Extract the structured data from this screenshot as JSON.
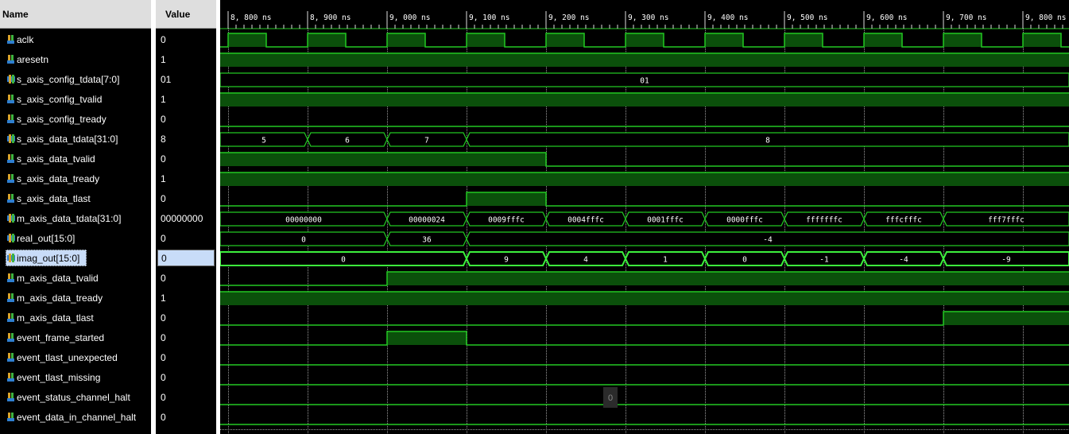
{
  "header": {
    "name_label": "Name",
    "value_label": "Value"
  },
  "time_ticks": [
    "8, 800 ns",
    "8, 900 ns",
    "9, 000 ns",
    "9, 100 ns",
    "9, 200 ns",
    "9, 300 ns",
    "9, 400 ns",
    "9, 500 ns",
    "9, 600 ns",
    "9, 700 ns",
    "9, 800 ns"
  ],
  "colors": {
    "wave": "#22c822",
    "fill": "#0b500b",
    "background": "#000000",
    "selected_value": "#c8dcf8"
  },
  "signals": [
    {
      "name": "aclk",
      "value": "0",
      "icon": "bit-signal-icon",
      "wave": {
        "type": "clock"
      }
    },
    {
      "name": "aresetn",
      "value": "1",
      "icon": "bit-signal-icon",
      "wave": {
        "type": "bit",
        "segments": [
          [
            0,
            10,
            1
          ]
        ]
      }
    },
    {
      "name": "s_axis_config_tdata[7:0]",
      "value": "01",
      "icon": "bus-signal-icon",
      "wave": {
        "type": "bus",
        "segments": [
          [
            0,
            10,
            "01"
          ]
        ]
      }
    },
    {
      "name": "s_axis_config_tvalid",
      "value": "1",
      "icon": "bit-signal-icon",
      "wave": {
        "type": "bit",
        "segments": [
          [
            0,
            10,
            1
          ]
        ]
      }
    },
    {
      "name": "s_axis_config_tready",
      "value": "0",
      "icon": "bit-signal-icon",
      "wave": {
        "type": "bit",
        "segments": [
          [
            0,
            10,
            0
          ]
        ]
      }
    },
    {
      "name": "s_axis_data_tdata[31:0]",
      "value": "8",
      "icon": "bus-signal-icon",
      "wave": {
        "type": "bus",
        "segments": [
          [
            0,
            1,
            "5"
          ],
          [
            1,
            2,
            "6"
          ],
          [
            2,
            3,
            "7"
          ],
          [
            3,
            10,
            "8"
          ]
        ]
      }
    },
    {
      "name": "s_axis_data_tvalid",
      "value": "0",
      "icon": "bit-signal-icon",
      "wave": {
        "type": "bit",
        "segments": [
          [
            0,
            4,
            1
          ],
          [
            4,
            10,
            0
          ]
        ]
      }
    },
    {
      "name": "s_axis_data_tready",
      "value": "1",
      "icon": "bit-signal-icon",
      "wave": {
        "type": "bit",
        "segments": [
          [
            0,
            10,
            1
          ]
        ]
      }
    },
    {
      "name": "s_axis_data_tlast",
      "value": "0",
      "icon": "bit-signal-icon",
      "wave": {
        "type": "bit",
        "segments": [
          [
            0,
            3,
            0
          ],
          [
            3,
            4,
            1
          ],
          [
            4,
            10,
            0
          ]
        ]
      }
    },
    {
      "name": "m_axis_data_tdata[31:0]",
      "value": "00000000",
      "icon": "bus-signal-icon",
      "wave": {
        "type": "bus",
        "segments": [
          [
            0,
            2,
            "00000000"
          ],
          [
            2,
            3,
            "00000024"
          ],
          [
            3,
            4,
            "0009fffc"
          ],
          [
            4,
            5,
            "0004fffc"
          ],
          [
            5,
            6,
            "0001fffc"
          ],
          [
            6,
            7,
            "0000fffc"
          ],
          [
            7,
            8,
            "fffffffc"
          ],
          [
            8,
            9,
            "fffcfffc"
          ],
          [
            9,
            10,
            "fff7fffc"
          ]
        ]
      }
    },
    {
      "name": "real_out[15:0]",
      "value": "0",
      "icon": "bus-signal-icon",
      "wave": {
        "type": "bus",
        "segments": [
          [
            0,
            2,
            "0"
          ],
          [
            2,
            3,
            "36"
          ],
          [
            3,
            10,
            "-4"
          ]
        ]
      }
    },
    {
      "name": "imag_out[15:0]",
      "value": "0",
      "icon": "bus-signal-icon",
      "selected": true,
      "wave": {
        "type": "bus",
        "highlight": true,
        "segments": [
          [
            0,
            3,
            "0"
          ],
          [
            3,
            4,
            "9"
          ],
          [
            4,
            5,
            "4"
          ],
          [
            5,
            6,
            "1"
          ],
          [
            6,
            7,
            "0"
          ],
          [
            7,
            8,
            "-1"
          ],
          [
            8,
            9,
            "-4"
          ],
          [
            9,
            10,
            "-9"
          ]
        ]
      }
    },
    {
      "name": "m_axis_data_tvalid",
      "value": "0",
      "icon": "bit-signal-icon",
      "wave": {
        "type": "bit",
        "segments": [
          [
            0,
            2,
            0
          ],
          [
            2,
            10,
            1
          ]
        ]
      }
    },
    {
      "name": "m_axis_data_tready",
      "value": "1",
      "icon": "bit-signal-icon",
      "wave": {
        "type": "bit",
        "segments": [
          [
            0,
            10,
            1
          ]
        ]
      }
    },
    {
      "name": "m_axis_data_tlast",
      "value": "0",
      "icon": "bit-signal-icon",
      "wave": {
        "type": "bit",
        "segments": [
          [
            0,
            9,
            0
          ],
          [
            9,
            10,
            1
          ]
        ]
      }
    },
    {
      "name": "event_frame_started",
      "value": "0",
      "icon": "bit-signal-icon",
      "wave": {
        "type": "bit",
        "segments": [
          [
            0,
            2,
            0
          ],
          [
            2,
            3,
            1
          ],
          [
            3,
            10,
            0
          ]
        ]
      }
    },
    {
      "name": "event_tlast_unexpected",
      "value": "0",
      "icon": "bit-signal-icon",
      "wave": {
        "type": "bit",
        "segments": [
          [
            0,
            10,
            0
          ]
        ]
      }
    },
    {
      "name": "event_tlast_missing",
      "value": "0",
      "icon": "bit-signal-icon",
      "wave": {
        "type": "bit",
        "segments": [
          [
            0,
            10,
            0
          ]
        ]
      }
    },
    {
      "name": "event_status_channel_halt",
      "value": "0",
      "icon": "bit-signal-icon",
      "wave": {
        "type": "bit",
        "segments": [
          [
            0,
            10,
            0
          ]
        ]
      }
    },
    {
      "name": "event_data_in_channel_halt",
      "value": "0",
      "icon": "bit-signal-icon",
      "wave": {
        "type": "bit",
        "segments": [
          [
            0,
            10,
            0
          ]
        ]
      }
    }
  ],
  "tooltip": {
    "text": "0"
  }
}
